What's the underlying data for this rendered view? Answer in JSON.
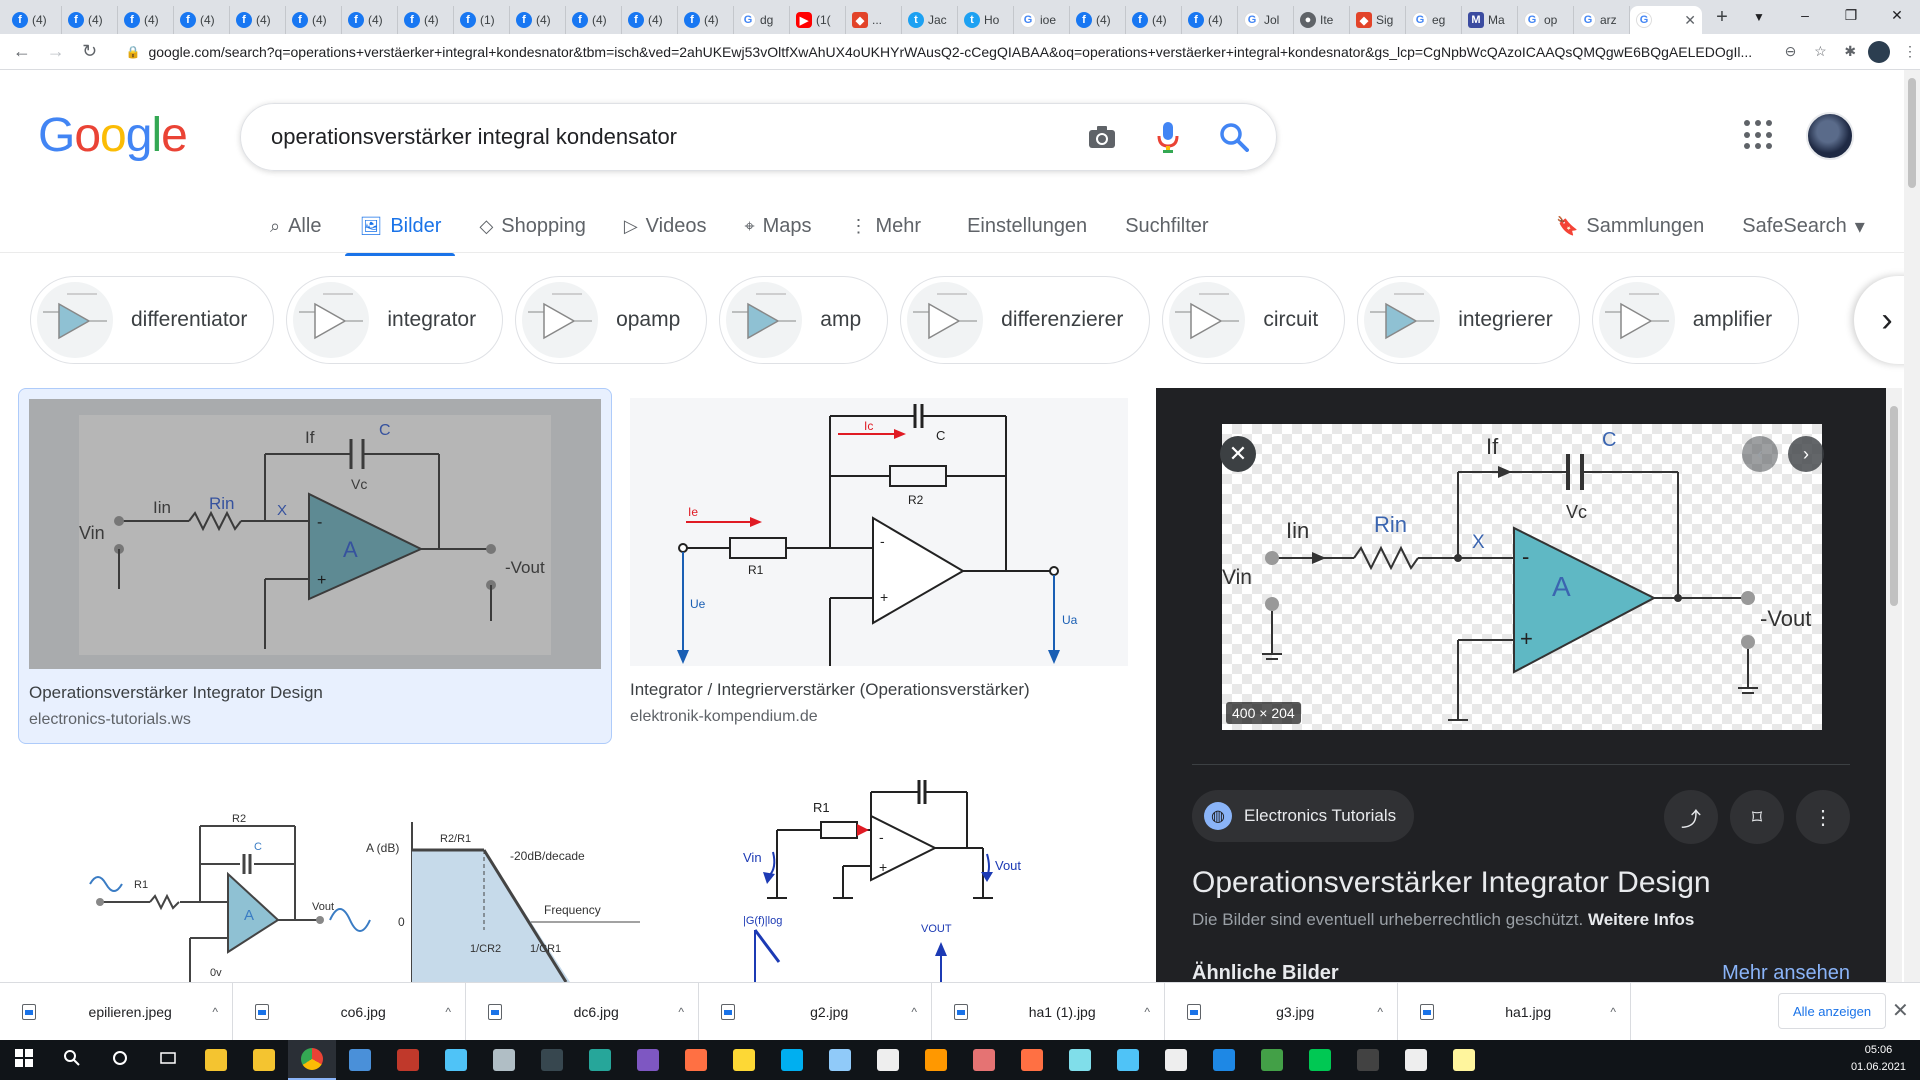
{
  "browser": {
    "tabs": [
      {
        "icon": "facebook-icon",
        "label": "(4)"
      },
      {
        "icon": "facebook-icon",
        "label": "(4)"
      },
      {
        "icon": "facebook-icon",
        "label": "(4)"
      },
      {
        "icon": "facebook-icon",
        "label": "(4)"
      },
      {
        "icon": "facebook-icon",
        "label": "(4)"
      },
      {
        "icon": "facebook-icon",
        "label": "(4)"
      },
      {
        "icon": "facebook-icon",
        "label": "(4)"
      },
      {
        "icon": "facebook-icon",
        "label": "(4)"
      },
      {
        "icon": "facebook-icon",
        "label": "(1)"
      },
      {
        "icon": "facebook-icon",
        "label": "(4)"
      },
      {
        "icon": "facebook-icon",
        "label": "(4)"
      },
      {
        "icon": "facebook-icon",
        "label": "(4)"
      },
      {
        "icon": "facebook-icon",
        "label": "(4)"
      },
      {
        "icon": "google-icon",
        "label": "dg"
      },
      {
        "icon": "youtube-icon",
        "label": "(1("
      },
      {
        "icon": "gitlab-icon",
        "label": "..."
      },
      {
        "icon": "twitter-icon",
        "label": "Jac"
      },
      {
        "icon": "twitter-icon",
        "label": "Ho"
      },
      {
        "icon": "google-icon",
        "label": "ioe"
      },
      {
        "icon": "facebook-icon",
        "label": "(4)"
      },
      {
        "icon": "facebook-icon",
        "label": "(4)"
      },
      {
        "icon": "facebook-icon",
        "label": "(4)"
      },
      {
        "icon": "google-icon",
        "label": "Jol"
      },
      {
        "icon": "web-icon",
        "label": "Ite"
      },
      {
        "icon": "gitlab-icon",
        "label": "Sig"
      },
      {
        "icon": "google-icon",
        "label": "eg"
      },
      {
        "icon": "m-icon",
        "label": "Ma"
      },
      {
        "icon": "google-icon",
        "label": "op"
      },
      {
        "icon": "google-icon",
        "label": "arz"
      }
    ],
    "active_tab": {
      "icon": "google-icon",
      "label": "G"
    },
    "url": "google.com/search?q=operations+verstäerker+integral+kondesnator&tbm=isch&ved=2ahUKEwj53vOltfXwAhUX4oUKHYrWAusQ2-cCegQIABAA&oq=operations+verstäerker+integral+kondesnator&gs_lcp=CgNpbWcQAzoICAAQsQMQgwE6BQgAELEDOgIl..."
  },
  "google": {
    "logo": [
      "G",
      "o",
      "o",
      "g",
      "l",
      "e"
    ],
    "logo_colors": [
      "#4285f4",
      "#ea4335",
      "#fbbc05",
      "#4285f4",
      "#34a853",
      "#ea4335"
    ],
    "query": "operationsverstärker integral kondensator",
    "tabs": [
      {
        "label": "Alle",
        "icon": "search-icon"
      },
      {
        "label": "Bilder",
        "icon": "image-icon",
        "active": true
      },
      {
        "label": "Shopping",
        "icon": "tag-icon"
      },
      {
        "label": "Videos",
        "icon": "play-icon"
      },
      {
        "label": "Maps",
        "icon": "pin-icon"
      },
      {
        "label": "Mehr",
        "icon": "more-vert-icon"
      }
    ],
    "settings": "Einstellungen",
    "filter": "Suchfilter",
    "collections": "Sammlungen",
    "safesearch": "SafeSearch"
  },
  "chips": [
    "differentiator",
    "integrator",
    "opamp",
    "amp",
    "differenzierer",
    "circuit",
    "integrierer",
    "amplifier"
  ],
  "results": [
    {
      "title": "Operationsverstärker Integrator Design",
      "site": "electronics-tutorials.ws"
    },
    {
      "title": "Integrator / Integrierverstärker (Operationsverstärker)",
      "site": "elektronik-kompendium.de"
    }
  ],
  "diagram_labels": {
    "if": "If",
    "c": "C",
    "iin": "Iin",
    "rin": "Rin",
    "x": "X",
    "vin": "Vin",
    "vc": "Vc",
    "a": "A",
    "minus": "-",
    "plus": "+",
    "vout": "-Vout",
    "ic": "Ic",
    "r2": "R2",
    "ie": "Ie",
    "r1": "R1",
    "ue": "Ue",
    "ua": "Ua",
    "adb": "A (dB)",
    "ratio": "R2/R1",
    "slope": "-20dB/decade",
    "freq": "Frequency",
    "zero": "0",
    "cr2": "1/CR2",
    "cr1": "1/CR1",
    "ov": "0v",
    "vout2": "Vout",
    "gf": "|G(f)|log",
    "vout3": "VOUT"
  },
  "panel": {
    "dims": "400 × 204",
    "source": "Electronics Tutorials",
    "title": "Operationsverstärker Integrator Design",
    "note": "Die Bilder sind eventuell urheberrechtlich geschützt.",
    "note_link": "Weitere Infos",
    "similar": "Ähnliche Bilder",
    "see_more": "Mehr ansehen"
  },
  "downloads": [
    "epilieren.jpeg",
    "co6.jpg",
    "dc6.jpg",
    "g2.jpg",
    "ha1 (1).jpg",
    "g3.jpg",
    "ha1.jpg"
  ],
  "downloads_show_all": "Alle anzeigen",
  "taskbar": {
    "apps": [
      {
        "icon": "windows-start-icon",
        "color": "#ffffff"
      },
      {
        "icon": "search-icon",
        "color": "#ffffff"
      },
      {
        "icon": "cortana-icon",
        "color": "#ffffff"
      },
      {
        "icon": "task-view-icon",
        "color": "#ffffff"
      },
      {
        "icon": "folder-icon",
        "color": "#f4c430"
      },
      {
        "icon": "store-icon",
        "color": "#f4c430"
      },
      {
        "icon": "chrome-icon",
        "color": "#e24329",
        "active": true
      },
      {
        "icon": "app-icon",
        "color": "#4a90d9"
      },
      {
        "icon": "voicemeeter-icon",
        "color": "#c0392b"
      },
      {
        "icon": "app-icon",
        "color": "#4fc3f7"
      },
      {
        "icon": "app-icon",
        "color": "#b0bec5"
      },
      {
        "icon": "live-icon",
        "color": "#37474f"
      },
      {
        "icon": "app-icon",
        "color": "#26a69a"
      },
      {
        "icon": "app-icon",
        "color": "#7e57c2"
      },
      {
        "icon": "firefox-icon",
        "color": "#ff7043"
      },
      {
        "icon": "pen-icon",
        "color": "#fdd835"
      },
      {
        "icon": "skype-icon",
        "color": "#00aff0"
      },
      {
        "icon": "box-icon",
        "color": "#90caf9"
      },
      {
        "icon": "app-icon",
        "color": "#eeeeee"
      },
      {
        "icon": "app-icon",
        "color": "#ff9800"
      },
      {
        "icon": "app-icon",
        "color": "#e57373"
      },
      {
        "icon": "app-icon",
        "color": "#ff7043"
      },
      {
        "icon": "app-icon",
        "color": "#80deea"
      },
      {
        "icon": "app-icon",
        "color": "#4fc3f7"
      },
      {
        "icon": "app-icon",
        "color": "#eeeeee"
      },
      {
        "icon": "app-icon",
        "color": "#1e88e5"
      },
      {
        "icon": "app-icon",
        "color": "#43a047"
      },
      {
        "icon": "app-icon",
        "color": "#00c853"
      },
      {
        "icon": "terminal-icon",
        "color": "#424242"
      },
      {
        "icon": "app-icon",
        "color": "#eeeeee"
      },
      {
        "icon": "notepad-icon",
        "color": "#fff59d"
      }
    ],
    "time": "05:06",
    "date": "01.06.2021"
  }
}
